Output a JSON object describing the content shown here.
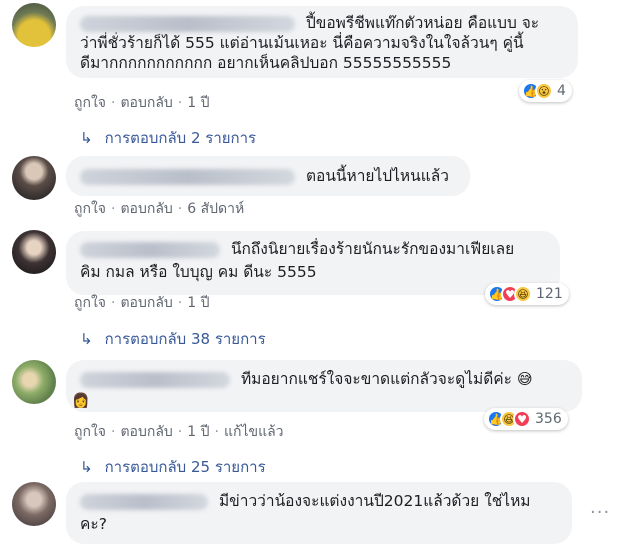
{
  "comments": [
    {
      "text_lines": [
        "ปี้ขอพรีชีพแท๊กตัวหน่อย คือแบบ จะ",
        "ว่าพี่ชั่วร้ายก็ได้ 555 แต่อ่านเม้นเหอะ นี่คือความจริงในใจล้วนๆ คู่นี้",
        "ดีมากกกกกกกกกกก อยากเห็นคลิปบอก 55555555555"
      ],
      "actions": [
        "ถูกใจ",
        "ตอบกลับ",
        "1 ปี"
      ],
      "reaction_icons": [
        "like-icon",
        "wow-icon"
      ],
      "reaction_count": "4",
      "replies": "การตอบกลับ 2 รายการ"
    },
    {
      "text_lines": [
        "ตอนนี้หายไปไหนแล้ว"
      ],
      "actions": [
        "ถูกใจ",
        "ตอบกลับ",
        "6 สัปดาห์"
      ]
    },
    {
      "text_lines": [
        "นึกถึงนิยายเรื่องร้ายนักนะรักของมาเฟียเลย",
        "คิม กมล หรือ ใบบุญ คม ดีนะ 5555"
      ],
      "actions": [
        "ถูกใจ",
        "ตอบกลับ",
        "1 ปี"
      ],
      "reaction_icons": [
        "like-icon",
        "love-icon",
        "haha-icon"
      ],
      "reaction_count": "121",
      "replies": "การตอบกลับ 38 รายการ"
    },
    {
      "text_lines": [
        "ทีมอยากแชร์ใจจะขาดแต่กลัวจะดูไม่ดีค่ะ"
      ],
      "emoji": "😅",
      "actions": [
        "ถูกใจ",
        "ตอบกลับ",
        "1 ปี",
        "แก้ไขแล้ว"
      ],
      "reaction_icons": [
        "like-icon",
        "haha-icon",
        "love-icon"
      ],
      "reaction_count": "356",
      "replies": "การตอบกลับ 25 รายการ"
    },
    {
      "text_lines": [
        "มีข่าวว่าน้องจะแต่งงานปี2021แล้วด้วย ใช่ไหม",
        "คะ?"
      ],
      "more": "···"
    }
  ],
  "colors": {
    "bubble": "#f2f3f5",
    "link": "#385898",
    "meta": "#606770"
  }
}
